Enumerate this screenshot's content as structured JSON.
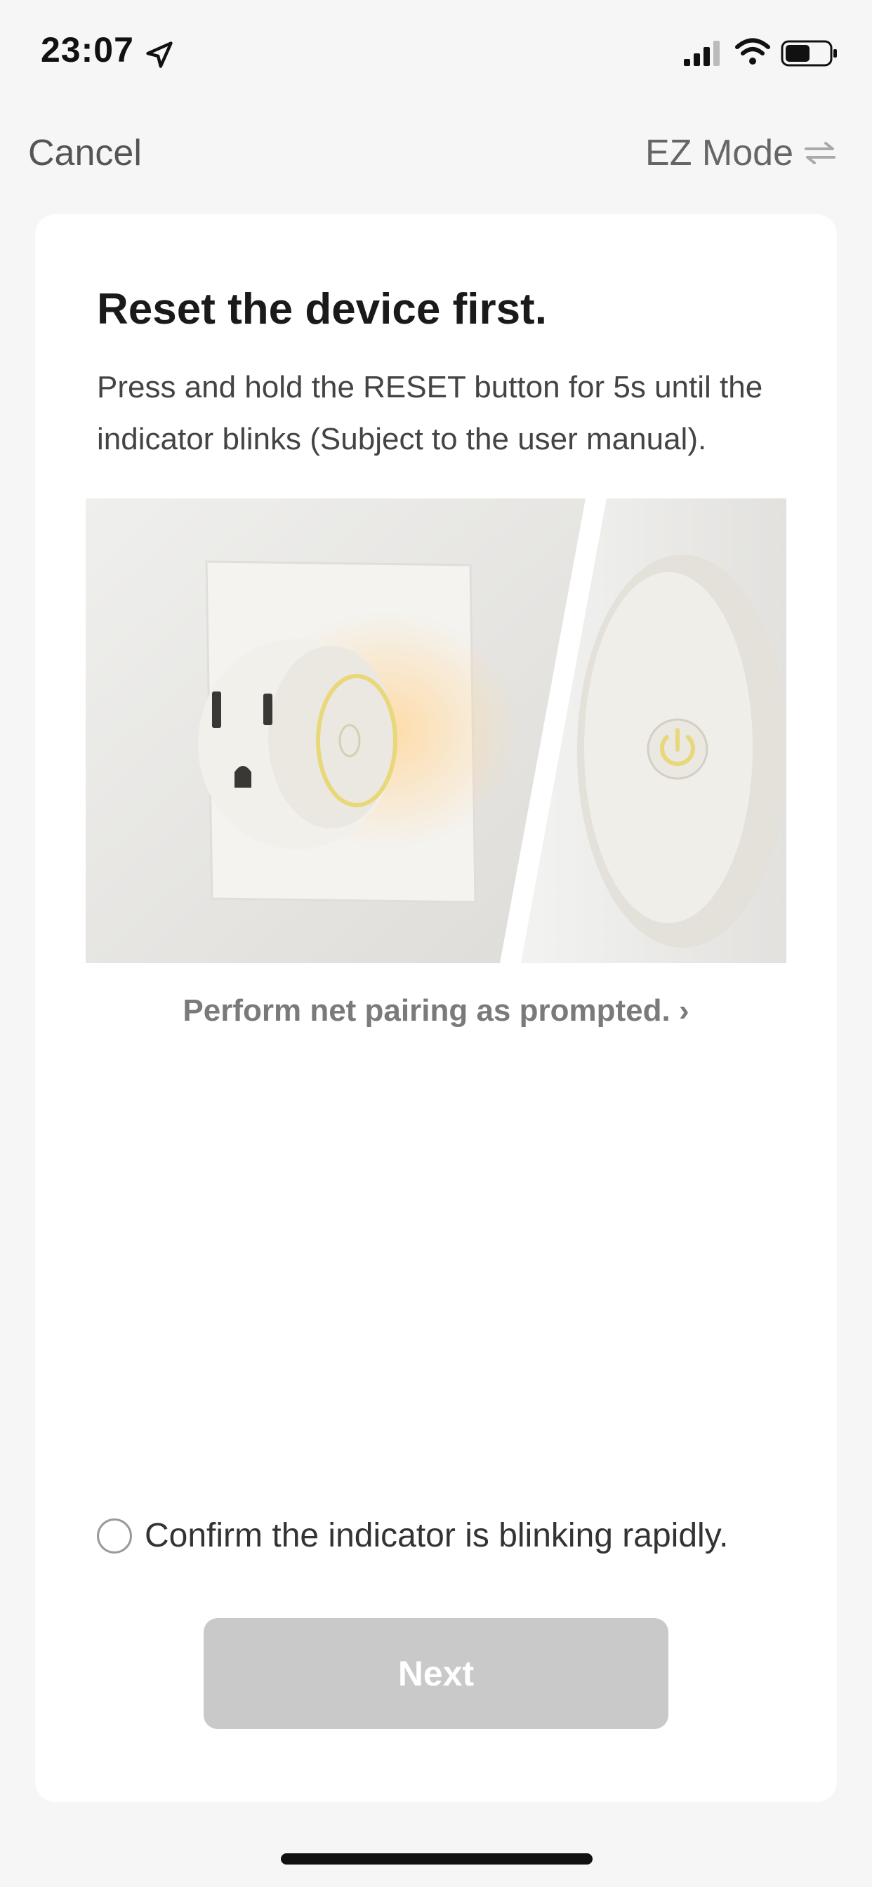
{
  "status_bar": {
    "time": "23:07",
    "icons": [
      "location-arrow-icon",
      "cellular-signal-icon",
      "wifi-icon",
      "battery-icon"
    ]
  },
  "nav": {
    "cancel_label": "Cancel",
    "mode_label": "EZ Mode",
    "mode_icon": "swap-icon"
  },
  "card": {
    "title": "Reset the device first.",
    "description": "Press and hold the RESET button for 5s until the indicator blinks (Subject to the user manual).",
    "pairing_link": "Perform net pairing as prompted. ›",
    "confirm_label": "Confirm the indicator is blinking rapidly.",
    "confirm_checked": false,
    "next_label": "Next"
  },
  "colors": {
    "background": "#f6f6f6",
    "card": "#ffffff",
    "button_disabled": "#c9c9c9",
    "indicator_glow": "#e8d87a"
  }
}
